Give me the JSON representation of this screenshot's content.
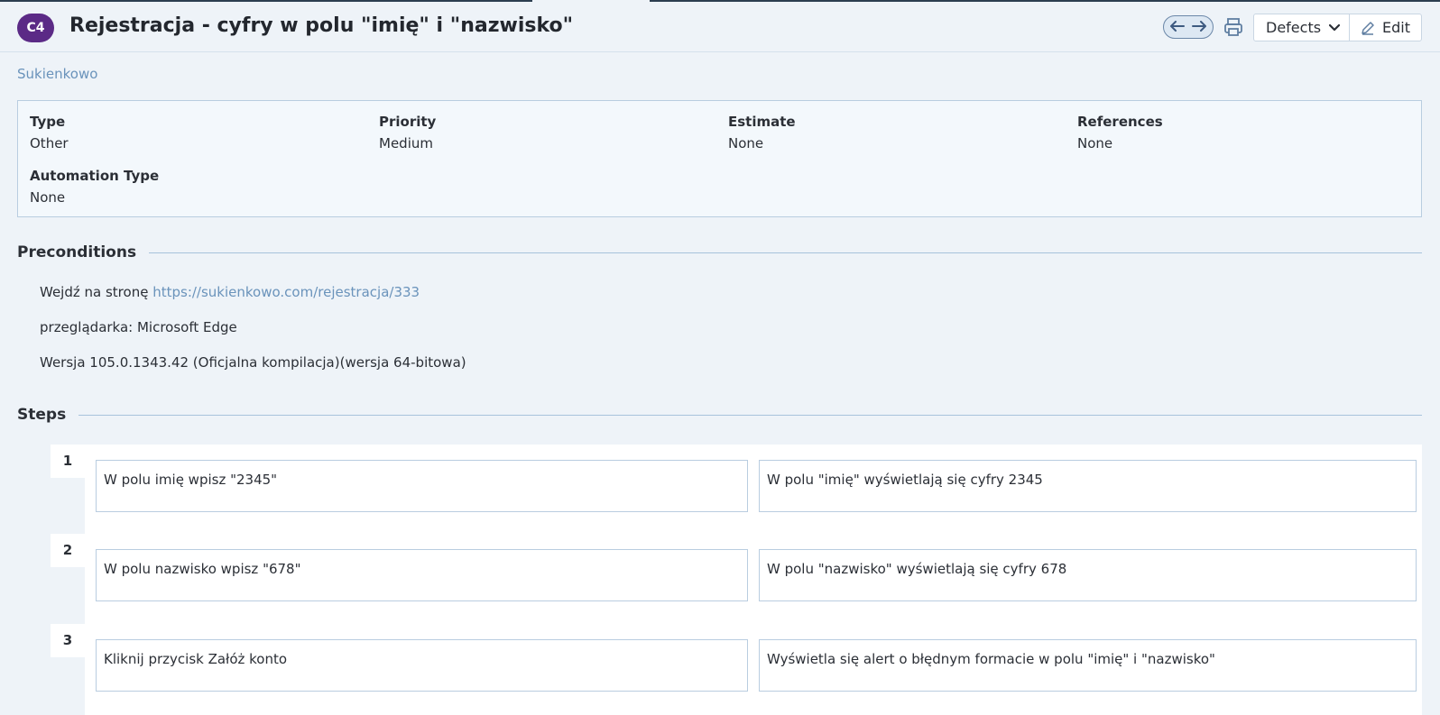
{
  "header": {
    "badge": "C4",
    "title": "Rejestracja - cyfry w polu \"imię\" i \"nazwisko\"",
    "defects_label": "Defects",
    "edit_label": "Edit"
  },
  "project_link": "Sukienkowo",
  "properties": [
    {
      "label": "Type",
      "value": "Other"
    },
    {
      "label": "Priority",
      "value": "Medium"
    },
    {
      "label": "Estimate",
      "value": "None"
    },
    {
      "label": "References",
      "value": "None"
    },
    {
      "label": "Automation Type",
      "value": "None"
    }
  ],
  "preconditions": {
    "heading": "Preconditions",
    "line1_prefix": "Wejdź na stronę",
    "line1_link": "https://sukienkowo.com/rejestracja/333",
    "line2": "przeglądarka: Microsoft Edge",
    "line3": "Wersja 105.0.1343.42 (Oficjalna kompilacja)(wersja 64-bitowa)"
  },
  "steps": {
    "heading": "Steps",
    "items": [
      {
        "num": "1",
        "action": "W polu imię wpisz \"2345\"",
        "expected": "W polu \"imię\" wyświetlają się cyfry 2345"
      },
      {
        "num": "2",
        "action": "W polu nazwisko wpisz \"678\"",
        "expected": "W polu \"nazwisko\" wyświetlają się cyfry 678"
      },
      {
        "num": "3",
        "action": "Kliknij przycisk Załóż konto",
        "expected": "Wyświetla się alert o błędnym formacie w polu \"imię\" i \"nazwisko\""
      }
    ]
  },
  "colors": {
    "badge": "#5b2a86",
    "link": "#6a93bb",
    "background": "#eef3f8"
  },
  "icons": [
    "arrow-left-icon",
    "arrow-right-icon",
    "printer-icon",
    "chevron-down-icon",
    "pencil-icon"
  ]
}
